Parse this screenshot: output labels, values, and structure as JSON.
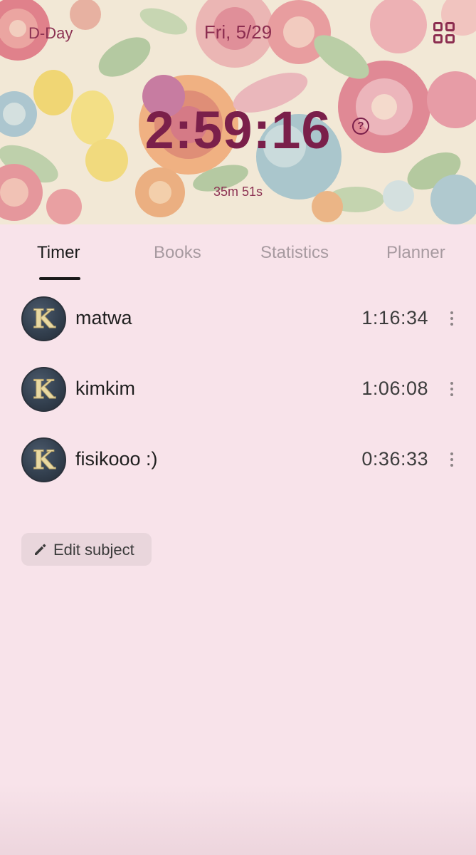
{
  "header": {
    "dday_label": "D-Day",
    "date": "Fri, 5/29",
    "menu_icon": "grid-icon",
    "timer": "2:59:16",
    "help_icon_glyph": "?",
    "sub_time": "35m 51s",
    "accent_color": "#7a1f4a"
  },
  "tabs": [
    {
      "label": "Timer",
      "active": true
    },
    {
      "label": "Books",
      "active": false
    },
    {
      "label": "Statistics",
      "active": false
    },
    {
      "label": "Planner",
      "active": false
    }
  ],
  "subjects": [
    {
      "name": "matwa",
      "time": "1:16:34",
      "avatar_letter": "K"
    },
    {
      "name": "kimkim",
      "time": "1:06:08",
      "avatar_letter": "K"
    },
    {
      "name": "fisikooo :)",
      "time": "0:36:33",
      "avatar_letter": "K"
    }
  ],
  "edit_button": {
    "label": "Edit subject",
    "icon": "pencil-icon"
  }
}
